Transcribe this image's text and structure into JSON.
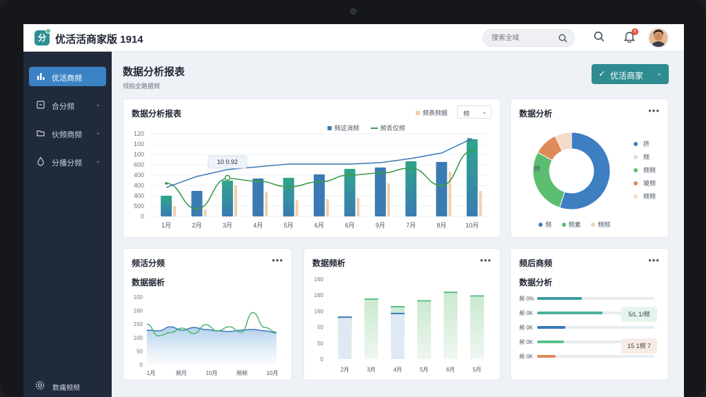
{
  "app": {
    "title": "优活活商家版 1914"
  },
  "header": {
    "search_placeholder": "搜索全域",
    "notification_count": "8"
  },
  "sidebar": {
    "items": [
      {
        "label": "优活商频",
        "icon": "chart-bar-icon",
        "active": true
      },
      {
        "label": "合分频",
        "icon": "doc-icon"
      },
      {
        "label": "伙频商频",
        "icon": "folder-icon"
      },
      {
        "label": "分播分频",
        "icon": "drop-icon"
      }
    ],
    "footer_label": "数痛频频"
  },
  "page": {
    "title": "数据分析报表",
    "subtitle": "领拍全路据频",
    "primary_button": "优活商家"
  },
  "main_chart": {
    "title": "数据分析报表",
    "legend_top": "频表频据",
    "filter_label": "频",
    "legend_bar": "频这消频",
    "legend_line": "频丢仅频",
    "tooltip": "10 0.92",
    "colors": {
      "bar": "#3a7bb3",
      "bar2": "#2fa58b",
      "bar_secondary": "#f1cfae",
      "line": "#3a9a4e",
      "trend": "#3a78b8"
    },
    "chart_data": {
      "type": "bar",
      "categories": [
        "1月",
        "2月",
        "3月",
        "4月",
        "5月",
        "6月",
        "6月",
        "9月",
        "7月",
        "8月",
        "10月"
      ],
      "y_ticks": [
        "0",
        "500",
        "400",
        "400",
        "400",
        "600",
        "100",
        "100",
        "120"
      ],
      "series": [
        {
          "name": "频这消频",
          "values": [
            30,
            37,
            52,
            55,
            56,
            61,
            69,
            71,
            80,
            79,
            112
          ]
        },
        {
          "values": [
            15,
            10,
            45,
            36,
            24,
            25,
            27,
            48,
            0,
            65,
            37
          ]
        },
        {
          "name": "频丢仅频",
          "values": [
            48,
            11,
            55,
            51,
            43,
            50,
            60,
            63,
            70,
            45,
            95
          ]
        },
        {
          "values": [
            42,
            58,
            68,
            72,
            76,
            76,
            76,
            78,
            84,
            92,
            113
          ]
        }
      ]
    }
  },
  "donut_card": {
    "title": "数据分析",
    "legend": [
      "挤",
      "频",
      "频频",
      "坡频",
      "频频"
    ],
    "bottom_legend": [
      "频",
      "频素",
      "频频"
    ],
    "center_label": "频",
    "chart_data": {
      "type": "pie",
      "labels": [
        "挤",
        "频",
        "频频",
        "坡频",
        "频频"
      ],
      "values": [
        55,
        0,
        28,
        10,
        7
      ],
      "colors": [
        "#3d7fc1",
        "#cfe0f0",
        "#5bbd6f",
        "#e08a5a",
        "#f3dac9"
      ]
    }
  },
  "area_card": {
    "title": "频活分频",
    "subtitle": "数据据析",
    "chart_data": {
      "type": "area",
      "x": [
        "1月",
        "频月",
        "10月",
        "频频",
        "10月"
      ],
      "y_ticks": [
        "0",
        "50",
        "100",
        "150",
        "160",
        "100"
      ],
      "series": [
        {
          "values": [
            120,
            85,
            95,
            108,
            92,
            118,
            100,
            112,
            96,
            154,
            110,
            96
          ]
        },
        {
          "values": [
            102,
            100,
            112,
            102,
            110,
            104,
            100,
            98,
            102,
            104,
            100,
            94
          ]
        }
      ]
    }
  },
  "bar_card": {
    "title": "数据频析",
    "chart_data": {
      "type": "bar",
      "categories": [
        "2月",
        "3月",
        "4月",
        "5月",
        "6月",
        "5月"
      ],
      "y_ticks": [
        "0",
        "50",
        "50",
        "160",
        "160",
        "160"
      ],
      "series": [
        {
          "values": [
            103,
            150,
            131,
            146,
            167,
            158
          ]
        }
      ]
    }
  },
  "progress_card": {
    "title": "频后商频",
    "subtitle": "数据分析",
    "rows": [
      {
        "label": "频 0%",
        "value": 0.38,
        "color": "#3a9aa0"
      },
      {
        "label": "频 0K",
        "value": 0.56,
        "color": "#48b09a"
      },
      {
        "label": "频 0K",
        "value": 0.24,
        "color": "#3a78b8"
      },
      {
        "label": "频 0K",
        "value": 0.23,
        "color": "#5cc18a"
      },
      {
        "label": "频 0K",
        "value": 0.16,
        "color": "#e08a5a"
      }
    ],
    "tag_top": "5/L 1/频",
    "tag_bottom": "15 1频 7"
  }
}
